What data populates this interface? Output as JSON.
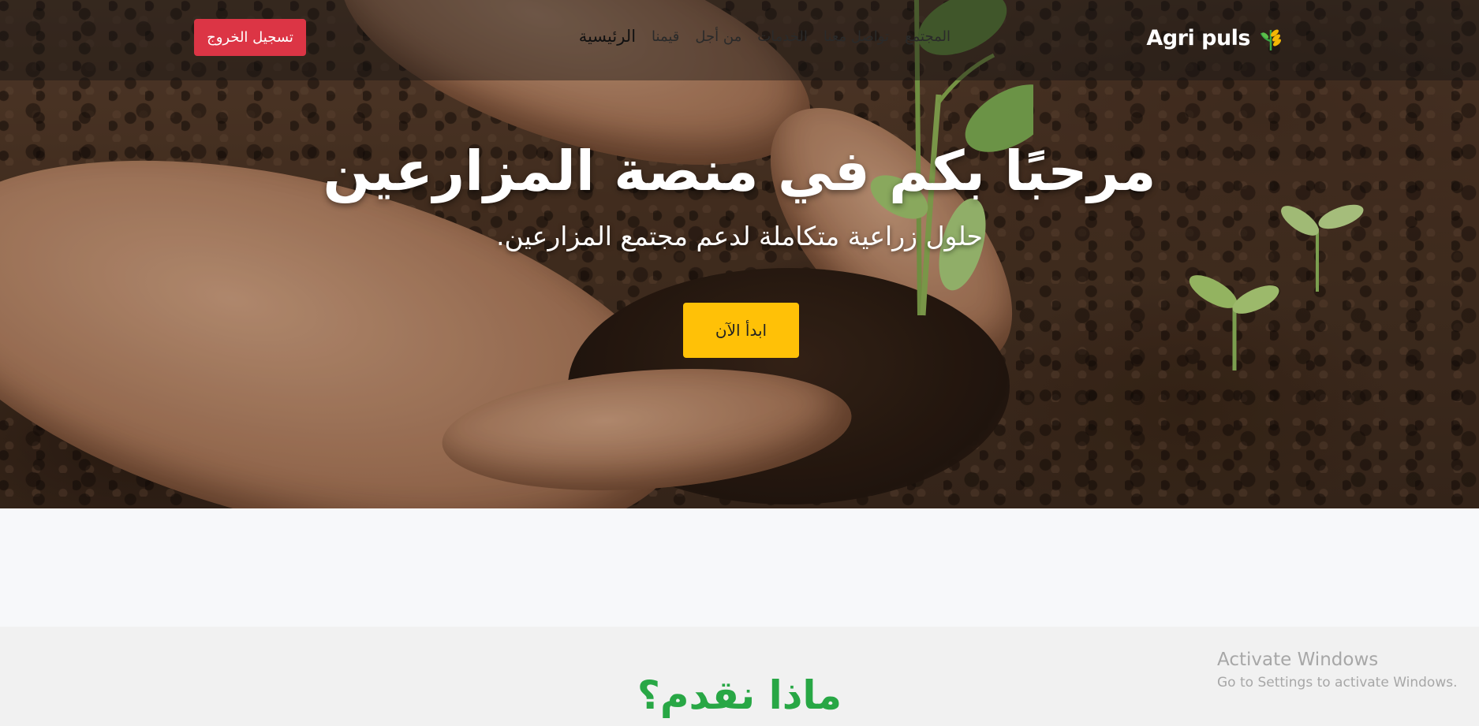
{
  "navbar": {
    "brand": "Agri puls",
    "brand_icon": "wheat-icon",
    "links": {
      "home": "الرئيسية",
      "about": "قيمنا",
      "why_us": "من أجل",
      "services": "الخدمات",
      "contact": "تواصل معنا",
      "community": "المجتمع"
    },
    "logout_label": "تسجيل الخروج"
  },
  "hero": {
    "title": "مرحبًا بكم في منصة المزارعين",
    "subtitle": "حلول زراعية متكاملة لدعم مجتمع المزارعين.",
    "cta_label": "ابدأ الآن",
    "image": "hands-holding-soil-with-seedling"
  },
  "services": {
    "title": "ماذا نقدم؟"
  },
  "windows_watermark": {
    "title": "Activate Windows",
    "subtitle": "Go to Settings to activate Windows."
  },
  "colors": {
    "logout": "#dc3545",
    "cta": "#ffc107",
    "section_title": "#28a745"
  }
}
